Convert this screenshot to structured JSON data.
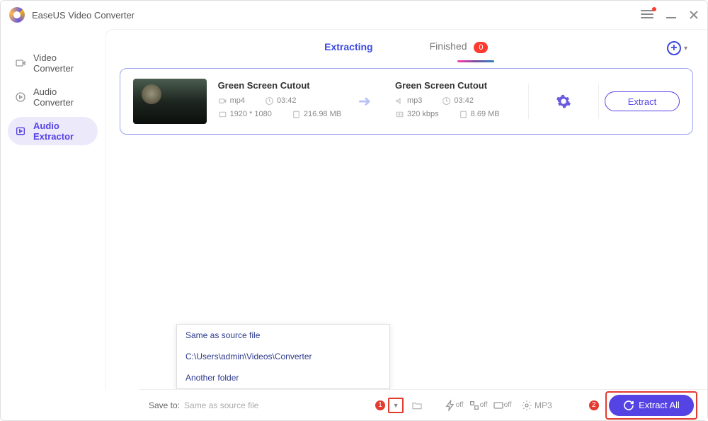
{
  "app_title": "EaseUS Video Converter",
  "sidebar": {
    "items": [
      {
        "label": "Video Converter"
      },
      {
        "label": "Audio Converter"
      },
      {
        "label": "Audio Extractor"
      }
    ]
  },
  "tabs": {
    "extracting": "Extracting",
    "finished": "Finished",
    "finished_count": "0"
  },
  "item": {
    "src": {
      "name": "Green Screen Cutout",
      "format": "mp4",
      "duration": "03:42",
      "resolution": "1920 * 1080",
      "size": "216.98 MB"
    },
    "dst": {
      "name": "Green Screen Cutout",
      "format": "mp3",
      "duration": "03:42",
      "bitrate": "320 kbps",
      "size": "8.69 MB"
    },
    "extract_label": "Extract"
  },
  "save": {
    "label": "Save to:",
    "value": "Same as source file",
    "options": [
      "Same as source file",
      "C:\\Users\\admin\\Videos\\Converter",
      "Another folder"
    ]
  },
  "toolbar": {
    "mp3": "MP3",
    "off": "off",
    "extract_all": "Extract All"
  },
  "annotations": {
    "a1": "1",
    "a2": "2"
  }
}
